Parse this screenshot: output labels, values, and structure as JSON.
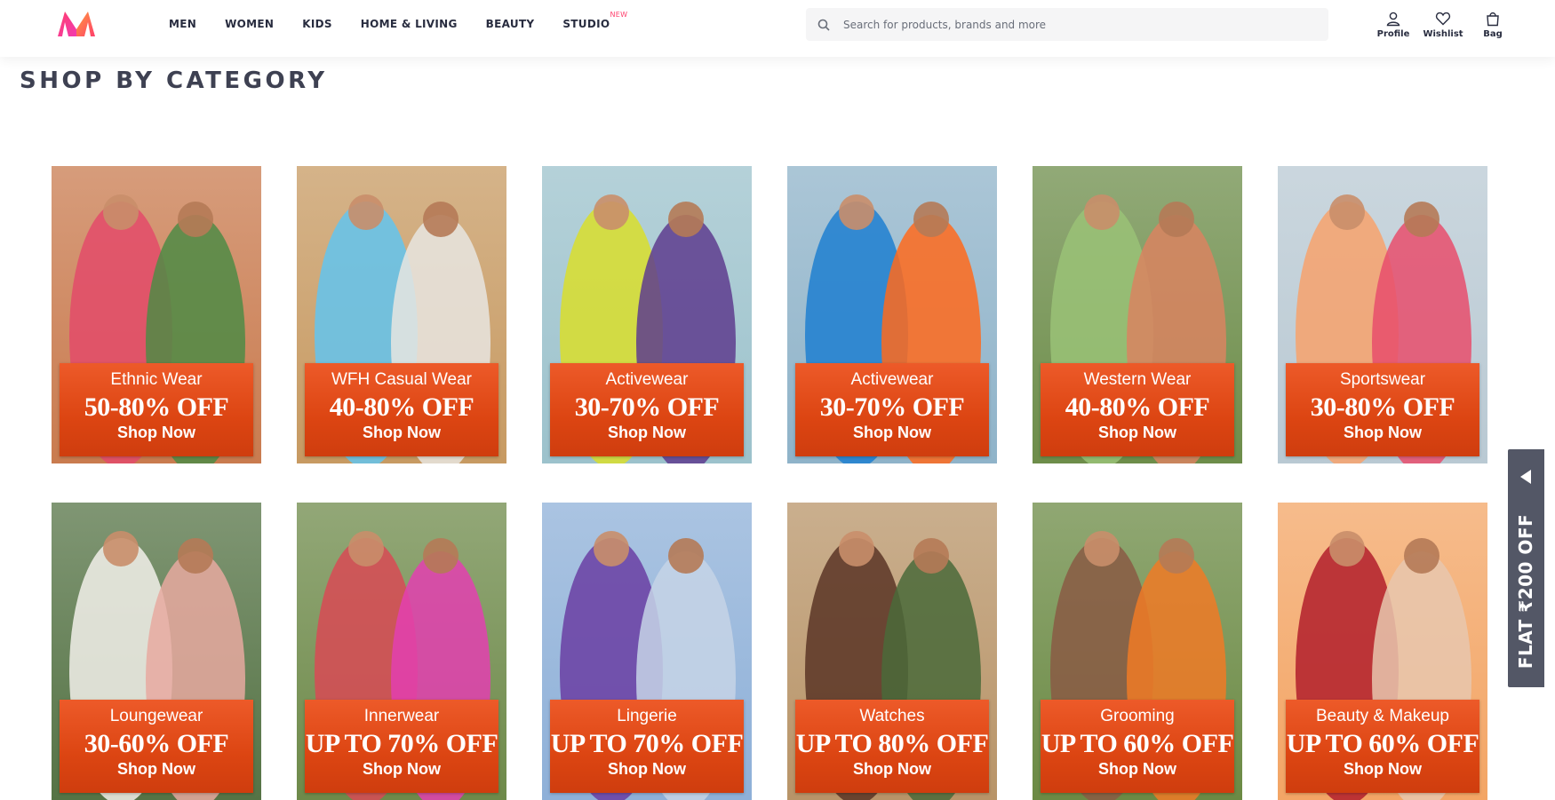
{
  "header": {
    "nav": [
      {
        "label": "MEN"
      },
      {
        "label": "WOMEN"
      },
      {
        "label": "KIDS"
      },
      {
        "label": "HOME & LIVING"
      },
      {
        "label": "BEAUTY"
      },
      {
        "label": "STUDIO",
        "badge": "NEW"
      }
    ],
    "search_placeholder": "Search for products, brands and more",
    "actions": [
      {
        "label": "Profile",
        "icon": "user-icon"
      },
      {
        "label": "Wishlist",
        "icon": "heart-icon"
      },
      {
        "label": "Bag",
        "icon": "bag-icon"
      }
    ]
  },
  "section": {
    "title": "SHOP BY CATEGORY"
  },
  "categories": [
    {
      "name": "Ethnic Wear",
      "offer": "50-80% OFF",
      "cta": "Shop Now",
      "colors": [
        "#c97b4f",
        "#e34b6a",
        "#4f8b45"
      ]
    },
    {
      "name": "WFH Casual Wear",
      "offer": "40-80% OFF",
      "cta": "Shop Now",
      "colors": [
        "#c79a62",
        "#63c4ef",
        "#e8e5e1"
      ]
    },
    {
      "name": "Activewear",
      "offer": "30-70% OFF",
      "cta": "Shop Now",
      "colors": [
        "#9cc2cc",
        "#d9de2c",
        "#5e3c8e"
      ]
    },
    {
      "name": "Activewear",
      "offer": "30-70% OFF",
      "cta": "Shop Now",
      "colors": [
        "#8fb3c9",
        "#1f7fd0",
        "#ff6a1c"
      ]
    },
    {
      "name": "Western Wear",
      "offer": "40-80% OFF",
      "cta": "Shop Now",
      "colors": [
        "#6d8d4a",
        "#9ac277",
        "#d98460"
      ]
    },
    {
      "name": "Sportswear",
      "offer": "30-80% OFF",
      "cta": "Shop Now",
      "colors": [
        "#b9c9d3",
        "#f7a26c",
        "#e84e6c"
      ]
    },
    {
      "name": "Loungewear",
      "offer": "30-60% OFF",
      "cta": "Shop Now",
      "colors": [
        "#557345",
        "#f2f0ea",
        "#e8a9a0"
      ]
    },
    {
      "name": "Innerwear",
      "offer": "UP TO 70% OFF",
      "cta": "Shop Now",
      "colors": [
        "#6e8a4a",
        "#d84a55",
        "#e33fb0"
      ]
    },
    {
      "name": "Lingerie",
      "offer": "UP TO 70% OFF",
      "cta": "Shop Now",
      "colors": [
        "#8eb0d8",
        "#6a3ea3",
        "#c6d3e6"
      ]
    },
    {
      "name": "Watches",
      "offer": "UP TO 80% OFF",
      "cta": "Shop Now",
      "colors": [
        "#b89468",
        "#5a3526",
        "#4a6a3a"
      ]
    },
    {
      "name": "Grooming",
      "offer": "UP TO 60% OFF",
      "cta": "Shop Now",
      "colors": [
        "#6b8a44",
        "#8a5a44",
        "#f07a26"
      ]
    },
    {
      "name": "Beauty & Makeup",
      "offer": "UP TO 60% OFF",
      "cta": "Shop Now",
      "colors": [
        "#f3a565",
        "#b21f2b",
        "#e8c7ae"
      ]
    }
  ],
  "coupon_tab": {
    "text": "FLAT ₹200 OFF"
  },
  "theme": {
    "accent": "#ff3f6c",
    "badge_orange": "#e04f1c"
  }
}
